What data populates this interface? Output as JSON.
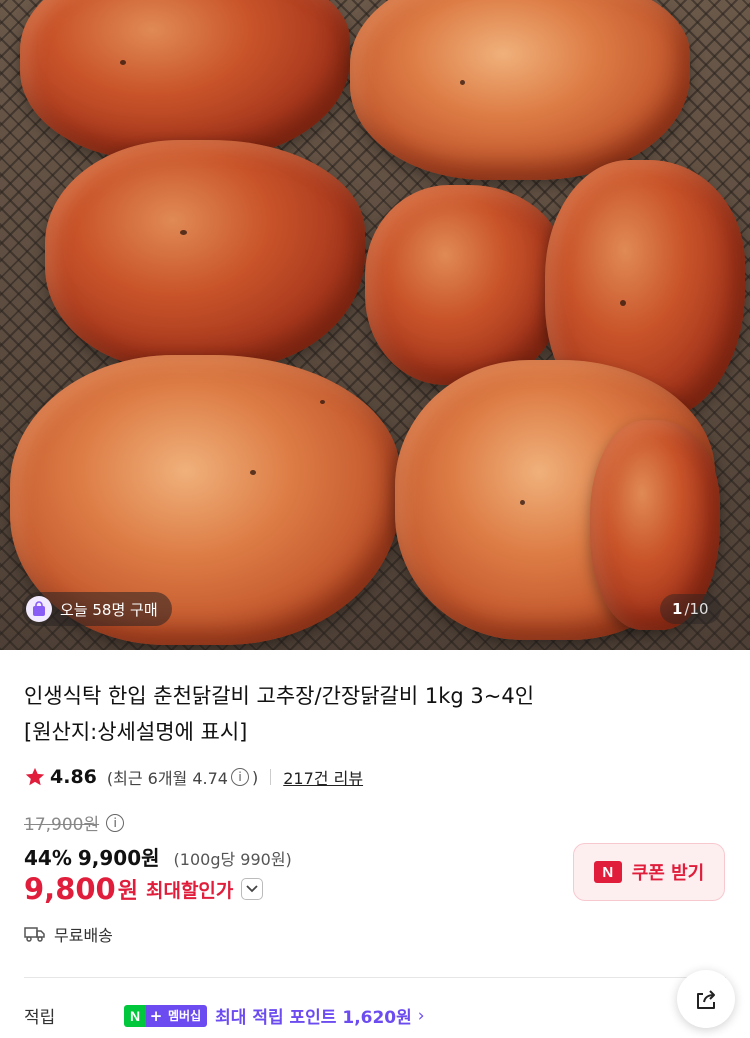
{
  "hero": {
    "today_badge_text": "오늘 58명 구매",
    "pager_current": "1",
    "pager_total": "/10"
  },
  "product": {
    "title_line1": "인생식탁 한입 춘천닭갈비 고추장/간장닭갈비 1kg 3~4인",
    "title_line2": "[원산지:상세설명에 표시]"
  },
  "rating": {
    "value": "4.86",
    "recent_text": "(최근 6개월 4.74",
    "recent_close": ")",
    "reviews_link": "217건 리뷰"
  },
  "price": {
    "original": "17,900원",
    "discount_pct": "44%",
    "sale_price": "9,900원",
    "unit_price": "(100g당 990원)",
    "final_price": "9,800",
    "final_won": "원",
    "final_label": "최대할인가"
  },
  "coupon": {
    "label": "쿠폰 받기",
    "logo_letter": "N"
  },
  "shipping": {
    "label": "무료배송"
  },
  "points": {
    "label": "적립",
    "badge_n": "N",
    "badge_plus": "+",
    "badge_member": "멤버십",
    "text": "최대 적립 포인트 1,620원",
    "chevron": "›"
  },
  "colors": {
    "accent_red": "#e01e3c",
    "membership_purple": "#6c4cf0",
    "naver_green": "#00c73c"
  },
  "icons": [
    "bag-icon",
    "star-icon",
    "info-icon",
    "chevron-down-icon",
    "truck-icon",
    "share-icon"
  ]
}
